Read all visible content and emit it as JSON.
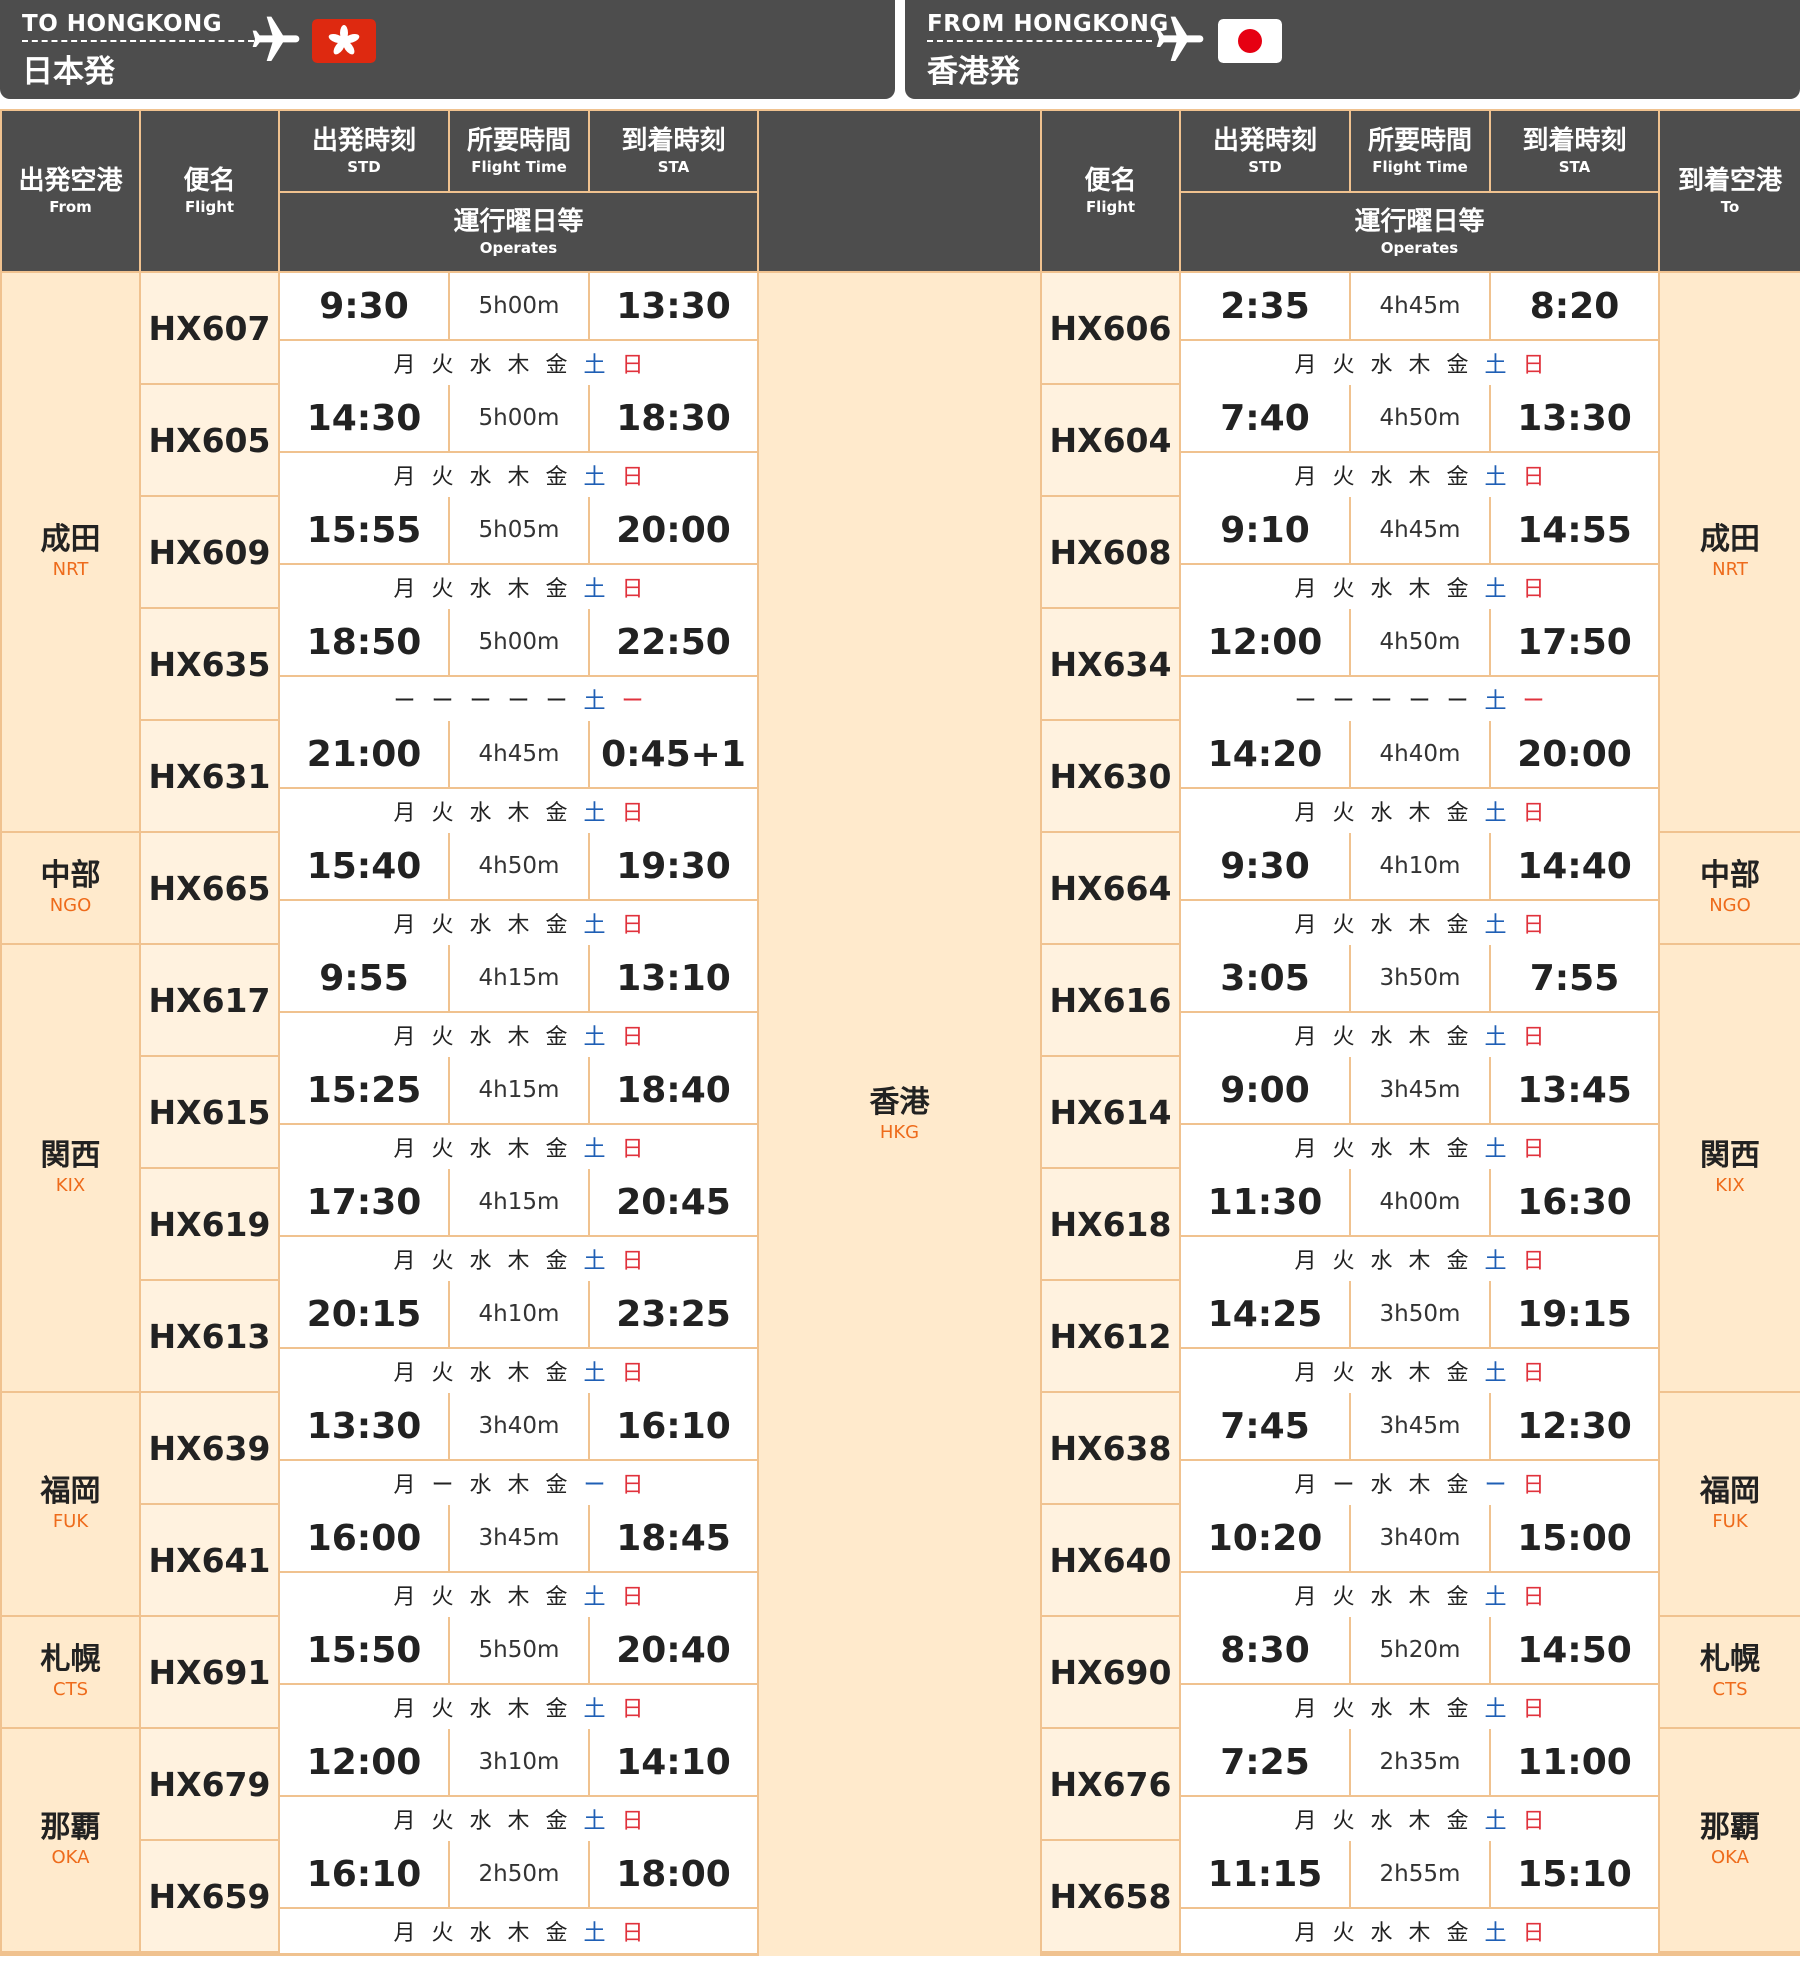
{
  "banners": [
    {
      "en": "TO HONGKONG",
      "ja": "日本発",
      "flag": "hong-kong-flag"
    },
    {
      "en": "FROM HONGKONG",
      "ja": "香港発",
      "flag": "japan-flag"
    }
  ],
  "headers": {
    "from": {
      "ja": "出発空港",
      "en": "From"
    },
    "flight": {
      "ja": "便名",
      "en": "Flight"
    },
    "std": {
      "ja": "出発時刻",
      "en": "STD"
    },
    "duration": {
      "ja": "所要時間",
      "en": "Flight Time"
    },
    "sta": {
      "ja": "到着時刻",
      "en": "STA"
    },
    "operates": {
      "ja": "運行曜日等",
      "en": "Operates"
    },
    "to": {
      "ja": "到着空港",
      "en": "To"
    }
  },
  "hub": {
    "name": "香港",
    "code": "HKG"
  },
  "colors": {
    "header_bg": "#4d4d4d",
    "airport_bg": "#ffeacc",
    "flight_bg": "#fff2df",
    "grid": "#f0c28f",
    "code": "#ee6b1b",
    "saturday": "#1f5fb5",
    "sunday": "#e0323c"
  },
  "groups": [
    {
      "name": "成田",
      "code": "NRT",
      "flights": [
        {
          "out": {
            "flight": "HX607",
            "std": "9:30",
            "dur": "5h00m",
            "sta": "13:30",
            "ops": [
              "月",
              "火",
              "水",
              "木",
              "金",
              "土",
              "日"
            ]
          },
          "ret": {
            "flight": "HX606",
            "std": "2:35",
            "dur": "4h45m",
            "sta": "8:20",
            "ops": [
              "月",
              "火",
              "水",
              "木",
              "金",
              "土",
              "日"
            ]
          }
        },
        {
          "out": {
            "flight": "HX605",
            "std": "14:30",
            "dur": "5h00m",
            "sta": "18:30",
            "ops": [
              "月",
              "火",
              "水",
              "木",
              "金",
              "土",
              "日"
            ]
          },
          "ret": {
            "flight": "HX604",
            "std": "7:40",
            "dur": "4h50m",
            "sta": "13:30",
            "ops": [
              "月",
              "火",
              "水",
              "木",
              "金",
              "土",
              "日"
            ]
          }
        },
        {
          "out": {
            "flight": "HX609",
            "std": "15:55",
            "dur": "5h05m",
            "sta": "20:00",
            "ops": [
              "月",
              "火",
              "水",
              "木",
              "金",
              "土",
              "日"
            ]
          },
          "ret": {
            "flight": "HX608",
            "std": "9:10",
            "dur": "4h45m",
            "sta": "14:55",
            "ops": [
              "月",
              "火",
              "水",
              "木",
              "金",
              "土",
              "日"
            ]
          }
        },
        {
          "out": {
            "flight": "HX635",
            "std": "18:50",
            "dur": "5h00m",
            "sta": "22:50",
            "ops": [
              "ー",
              "ー",
              "ー",
              "ー",
              "ー",
              "土",
              "ー"
            ]
          },
          "ret": {
            "flight": "HX634",
            "std": "12:00",
            "dur": "4h50m",
            "sta": "17:50",
            "ops": [
              "ー",
              "ー",
              "ー",
              "ー",
              "ー",
              "土",
              "ー"
            ]
          }
        },
        {
          "out": {
            "flight": "HX631",
            "std": "21:00",
            "dur": "4h45m",
            "sta": "0:45+1",
            "ops": [
              "月",
              "火",
              "水",
              "木",
              "金",
              "土",
              "日"
            ]
          },
          "ret": {
            "flight": "HX630",
            "std": "14:20",
            "dur": "4h40m",
            "sta": "20:00",
            "ops": [
              "月",
              "火",
              "水",
              "木",
              "金",
              "土",
              "日"
            ]
          }
        }
      ]
    },
    {
      "name": "中部",
      "code": "NGO",
      "flights": [
        {
          "out": {
            "flight": "HX665",
            "std": "15:40",
            "dur": "4h50m",
            "sta": "19:30",
            "ops": [
              "月",
              "火",
              "水",
              "木",
              "金",
              "土",
              "日"
            ]
          },
          "ret": {
            "flight": "HX664",
            "std": "9:30",
            "dur": "4h10m",
            "sta": "14:40",
            "ops": [
              "月",
              "火",
              "水",
              "木",
              "金",
              "土",
              "日"
            ]
          }
        }
      ]
    },
    {
      "name": "関西",
      "code": "KIX",
      "flights": [
        {
          "out": {
            "flight": "HX617",
            "std": "9:55",
            "dur": "4h15m",
            "sta": "13:10",
            "ops": [
              "月",
              "火",
              "水",
              "木",
              "金",
              "土",
              "日"
            ]
          },
          "ret": {
            "flight": "HX616",
            "std": "3:05",
            "dur": "3h50m",
            "sta": "7:55",
            "ops": [
              "月",
              "火",
              "水",
              "木",
              "金",
              "土",
              "日"
            ]
          }
        },
        {
          "out": {
            "flight": "HX615",
            "std": "15:25",
            "dur": "4h15m",
            "sta": "18:40",
            "ops": [
              "月",
              "火",
              "水",
              "木",
              "金",
              "土",
              "日"
            ]
          },
          "ret": {
            "flight": "HX614",
            "std": "9:00",
            "dur": "3h45m",
            "sta": "13:45",
            "ops": [
              "月",
              "火",
              "水",
              "木",
              "金",
              "土",
              "日"
            ]
          }
        },
        {
          "out": {
            "flight": "HX619",
            "std": "17:30",
            "dur": "4h15m",
            "sta": "20:45",
            "ops": [
              "月",
              "火",
              "水",
              "木",
              "金",
              "土",
              "日"
            ]
          },
          "ret": {
            "flight": "HX618",
            "std": "11:30",
            "dur": "4h00m",
            "sta": "16:30",
            "ops": [
              "月",
              "火",
              "水",
              "木",
              "金",
              "土",
              "日"
            ]
          }
        },
        {
          "out": {
            "flight": "HX613",
            "std": "20:15",
            "dur": "4h10m",
            "sta": "23:25",
            "ops": [
              "月",
              "火",
              "水",
              "木",
              "金",
              "土",
              "日"
            ]
          },
          "ret": {
            "flight": "HX612",
            "std": "14:25",
            "dur": "3h50m",
            "sta": "19:15",
            "ops": [
              "月",
              "火",
              "水",
              "木",
              "金",
              "土",
              "日"
            ]
          }
        }
      ]
    },
    {
      "name": "福岡",
      "code": "FUK",
      "flights": [
        {
          "out": {
            "flight": "HX639",
            "std": "13:30",
            "dur": "3h40m",
            "sta": "16:10",
            "ops": [
              "月",
              "ー",
              "水",
              "木",
              "金",
              "ー",
              "日"
            ]
          },
          "ret": {
            "flight": "HX638",
            "std": "7:45",
            "dur": "3h45m",
            "sta": "12:30",
            "ops": [
              "月",
              "ー",
              "水",
              "木",
              "金",
              "ー",
              "日"
            ]
          }
        },
        {
          "out": {
            "flight": "HX641",
            "std": "16:00",
            "dur": "3h45m",
            "sta": "18:45",
            "ops": [
              "月",
              "火",
              "水",
              "木",
              "金",
              "土",
              "日"
            ]
          },
          "ret": {
            "flight": "HX640",
            "std": "10:20",
            "dur": "3h40m",
            "sta": "15:00",
            "ops": [
              "月",
              "火",
              "水",
              "木",
              "金",
              "土",
              "日"
            ]
          }
        }
      ]
    },
    {
      "name": "札幌",
      "code": "CTS",
      "flights": [
        {
          "out": {
            "flight": "HX691",
            "std": "15:50",
            "dur": "5h50m",
            "sta": "20:40",
            "ops": [
              "月",
              "火",
              "水",
              "木",
              "金",
              "土",
              "日"
            ]
          },
          "ret": {
            "flight": "HX690",
            "std": "8:30",
            "dur": "5h20m",
            "sta": "14:50",
            "ops": [
              "月",
              "火",
              "水",
              "木",
              "金",
              "土",
              "日"
            ]
          }
        }
      ]
    },
    {
      "name": "那覇",
      "code": "OKA",
      "flights": [
        {
          "out": {
            "flight": "HX679",
            "std": "12:00",
            "dur": "3h10m",
            "sta": "14:10",
            "ops": [
              "月",
              "火",
              "水",
              "木",
              "金",
              "土",
              "日"
            ]
          },
          "ret": {
            "flight": "HX676",
            "std": "7:25",
            "dur": "2h35m",
            "sta": "11:00",
            "ops": [
              "月",
              "火",
              "水",
              "木",
              "金",
              "土",
              "日"
            ]
          }
        },
        {
          "out": {
            "flight": "HX659",
            "std": "16:10",
            "dur": "2h50m",
            "sta": "18:00",
            "ops": [
              "月",
              "火",
              "水",
              "木",
              "金",
              "土",
              "日"
            ]
          },
          "ret": {
            "flight": "HX658",
            "std": "11:15",
            "dur": "2h55m",
            "sta": "15:10",
            "ops": [
              "月",
              "火",
              "水",
              "木",
              "金",
              "土",
              "日"
            ]
          }
        }
      ]
    }
  ]
}
